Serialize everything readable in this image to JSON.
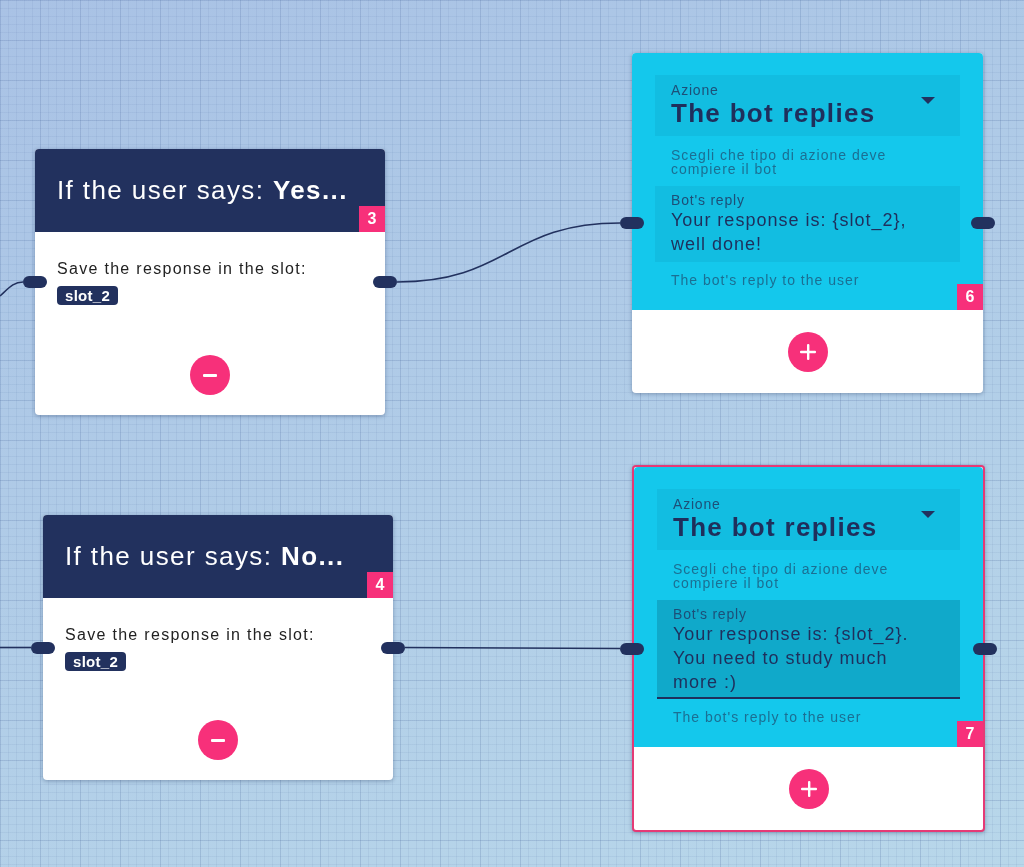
{
  "nodes": [
    {
      "kind": "condition",
      "selected": false,
      "title": "If the user says: **Yes...**",
      "number": "3",
      "instruction": "Save the response in the slot:",
      "slot": "slot_2"
    },
    {
      "kind": "action",
      "selected": false,
      "action": {
        "label": "Azione",
        "value": "The bot replies"
      },
      "action_helper": "Scegli che tipo di azione deve compiere il bot",
      "reply": {
        "label": "Bot's reply",
        "value": "Your response is: {slot_2}, well done!",
        "focused": false
      },
      "reply_helper": "The bot's reply to the user",
      "number": "6"
    },
    {
      "kind": "condition",
      "selected": false,
      "title": "If the user says: **No...**",
      "number": "4",
      "instruction": "Save the response in the slot:",
      "slot": "slot_2"
    },
    {
      "kind": "action",
      "selected": true,
      "action": {
        "label": "Azione",
        "value": "The bot replies"
      },
      "action_helper": "Scegli che tipo di azione deve compiere il bot",
      "reply": {
        "label": "Bot's reply",
        "value": "Your response is: {slot_2}. You need to study much more :)",
        "focused": true
      },
      "reply_helper": "The bot's reply to the user",
      "number": "7"
    }
  ]
}
